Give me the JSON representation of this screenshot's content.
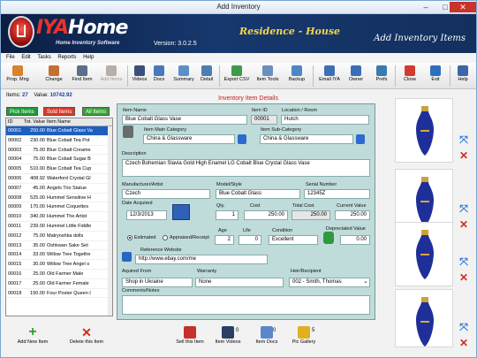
{
  "window": {
    "title": "Add Inventory"
  },
  "banner": {
    "brand_prefix": "IYA",
    "brand_suffix": "Home",
    "tagline": "Home Inventory Software",
    "version": "Version: 3.0.2.5",
    "residence": "Residence - House",
    "module": "Add Inventory Items"
  },
  "menu": [
    "File",
    "Edit",
    "Tasks",
    "Reports",
    "Help"
  ],
  "toolbar": [
    {
      "label": "Prop. Mng",
      "icon": "property-manager-icon",
      "color": "#d9822b"
    },
    {
      "label": "Change",
      "icon": "change-user-icon",
      "color": "#c66f35"
    },
    {
      "label": "Find Item",
      "icon": "find-item-icon",
      "color": "#5b6e8c"
    },
    {
      "label": "Add Items",
      "icon": "add-items-icon",
      "color": "#b8b0a6"
    },
    {
      "label": "Videos",
      "icon": "videos-icon",
      "color": "#3c4f7a"
    },
    {
      "label": "Docs",
      "icon": "docs-icon",
      "color": "#4a78b8"
    },
    {
      "label": "Summary",
      "icon": "summary-icon",
      "color": "#5c8fc9"
    },
    {
      "label": "Detail",
      "icon": "detail-icon",
      "color": "#4a7fb0"
    },
    {
      "label": "Export CSV",
      "icon": "export-csv-icon",
      "color": "#3f9a4a"
    },
    {
      "label": "Item Tools",
      "icon": "item-tools-icon",
      "color": "#6b8fbf"
    },
    {
      "label": "Backup",
      "icon": "backup-icon",
      "color": "#4f86c6"
    },
    {
      "label": "Email IYA",
      "icon": "email-icon",
      "color": "#3e6fb4"
    },
    {
      "label": "Owner",
      "icon": "owner-icon",
      "color": "#3a6fb8"
    },
    {
      "label": "Prefs",
      "icon": "preferences-icon",
      "color": "#3a7ab0"
    },
    {
      "label": "Close",
      "icon": "close-icon",
      "color": "#d33b2c"
    },
    {
      "label": "Exit",
      "icon": "exit-icon",
      "color": "#2c6fc1"
    },
    {
      "label": "Help",
      "icon": "help-icon",
      "color": "#3d66a8"
    }
  ],
  "stats": {
    "items_label": "Items:",
    "items_value": "27",
    "value_label": "Value:",
    "value_value": "10742.92"
  },
  "filters": {
    "pick": "Pick Items",
    "sold": "Sold Items",
    "all": "All Items"
  },
  "list": {
    "headers": [
      "ID",
      "Tot. Value",
      "Item Name"
    ],
    "rows": [
      [
        "00001",
        "250.00",
        "Blue Cobalt Glass Va"
      ],
      [
        "00002",
        "230.00",
        "Blue Cobalt Tea Pot"
      ],
      [
        "00003",
        "75.00",
        "Blue Cobalt Creame"
      ],
      [
        "00004",
        "75.00",
        "Blue Cobalt Sugar B"
      ],
      [
        "00005",
        "510.00",
        "Blue Cobalt Tea Cup"
      ],
      [
        "00006",
        "408.92",
        "Waterford Crystal Gl"
      ],
      [
        "00007",
        "45.00",
        "Angels Trio Statue"
      ],
      [
        "00008",
        "525.00",
        "Hummel Sensitive H"
      ],
      [
        "00009",
        "170.00",
        "Hummel Coquettes"
      ],
      [
        "00010",
        "340.00",
        "Hummel The Artist"
      ],
      [
        "00011",
        "239.00",
        "Hummel Little Fiddle"
      ],
      [
        "00012",
        "75.00",
        "Matryoshka dolls"
      ],
      [
        "00013",
        "35.00",
        "Oshkwan Sake Set"
      ],
      [
        "00014",
        "33.00",
        "Willow Tree Togethe"
      ],
      [
        "00015",
        "30.00",
        "Willow Tree Angel o"
      ],
      [
        "00016",
        "25.00",
        "Old Farmer Male"
      ],
      [
        "00017",
        "25.00",
        "Old Farmer Female"
      ],
      [
        "00018",
        "150.00",
        "Four Poster Queen I"
      ]
    ]
  },
  "bottom_left": {
    "add": "Add New Item",
    "delete": "Delete this Item"
  },
  "detail": {
    "header": "Inventory Item Details",
    "item_name_label": "Item Name",
    "item_name": "Blue Cobalt Glass Vase",
    "item_id_label": "Item ID",
    "item_id": "00001",
    "location_label": "Location / Room",
    "location": "Hutch",
    "main_cat_label": "Item Main Category",
    "main_cat": "China & Glassware",
    "sub_cat_label": "Item Sub-Category",
    "sub_cat": "China & Glassware",
    "description_label": "Description",
    "description": "Czech Bohemian Slavia Gold High Enamel LG Cobalt Blue Crystal Glass Vase",
    "manufacturer_label": "Manufacturer/Artist",
    "manufacturer": "Czech",
    "model_label": "Model/Style",
    "model": "Blue Cobalt Glass",
    "serial_label": "Serial Number",
    "serial": "12345Z",
    "date_label": "Date Acquired",
    "date": "12/3/2013",
    "qty_label": "Qty.",
    "qty": "1",
    "cost_label": "Cost",
    "cost": "250.00",
    "total_label": "Total Cost",
    "total": "250.00",
    "current_label": "Current Value",
    "current": "250.00",
    "estimated_label": "Estimated",
    "appraised_label": "Appraised/Receipt",
    "age_label": "Age",
    "age": "2",
    "life_label": "Life",
    "life": "0",
    "condition_label": "Condition",
    "condition": "Excellent",
    "depreciated_label": "Depreciated Value",
    "depreciated": "0.00",
    "website_label": "Reference Website",
    "website": "http://www.ebay.com/me",
    "acquired_label": "Aquired From",
    "acquired": "Shop in Ukraine",
    "warranty_label": "Warranty",
    "warranty": "None",
    "heir_label": "Heir/Recipient",
    "heir": "002 - Smith, Thomas",
    "comments_label": "Comments/Notes"
  },
  "bottom_mid": {
    "sell": "Sell this Item",
    "videos": "Item Videos",
    "videos_count": "0",
    "docs": "Item Docs",
    "docs_count": "0",
    "gallery": "Pic Gallery",
    "gallery_count": "5"
  },
  "colors": {
    "accent": "#1d5fbf",
    "panel": "#bfdcdb",
    "brand_red": "#e8332a",
    "residence": "#f2d64a"
  }
}
